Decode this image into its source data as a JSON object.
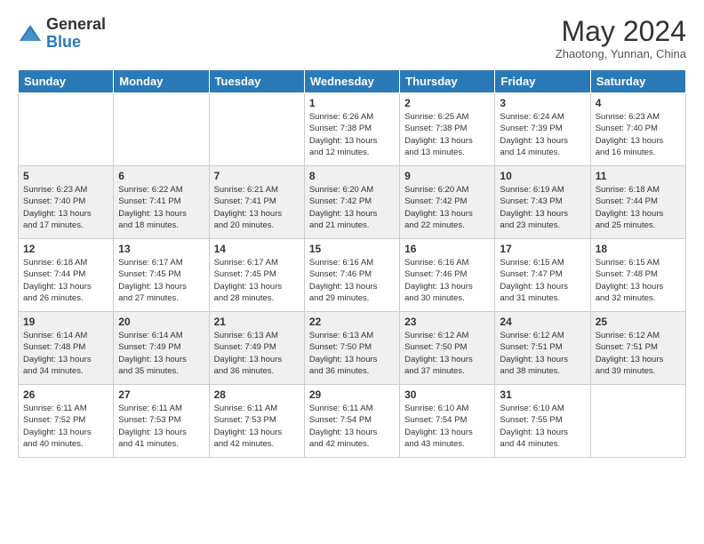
{
  "header": {
    "logo_general": "General",
    "logo_blue": "Blue",
    "month_year": "May 2024",
    "location": "Zhaotong, Yunnan, China"
  },
  "days_of_week": [
    "Sunday",
    "Monday",
    "Tuesday",
    "Wednesday",
    "Thursday",
    "Friday",
    "Saturday"
  ],
  "weeks": [
    [
      {
        "num": "",
        "info": ""
      },
      {
        "num": "",
        "info": ""
      },
      {
        "num": "",
        "info": ""
      },
      {
        "num": "1",
        "info": "Sunrise: 6:26 AM\nSunset: 7:38 PM\nDaylight: 13 hours\nand 12 minutes."
      },
      {
        "num": "2",
        "info": "Sunrise: 6:25 AM\nSunset: 7:38 PM\nDaylight: 13 hours\nand 13 minutes."
      },
      {
        "num": "3",
        "info": "Sunrise: 6:24 AM\nSunset: 7:39 PM\nDaylight: 13 hours\nand 14 minutes."
      },
      {
        "num": "4",
        "info": "Sunrise: 6:23 AM\nSunset: 7:40 PM\nDaylight: 13 hours\nand 16 minutes."
      }
    ],
    [
      {
        "num": "5",
        "info": "Sunrise: 6:23 AM\nSunset: 7:40 PM\nDaylight: 13 hours\nand 17 minutes."
      },
      {
        "num": "6",
        "info": "Sunrise: 6:22 AM\nSunset: 7:41 PM\nDaylight: 13 hours\nand 18 minutes."
      },
      {
        "num": "7",
        "info": "Sunrise: 6:21 AM\nSunset: 7:41 PM\nDaylight: 13 hours\nand 20 minutes."
      },
      {
        "num": "8",
        "info": "Sunrise: 6:20 AM\nSunset: 7:42 PM\nDaylight: 13 hours\nand 21 minutes."
      },
      {
        "num": "9",
        "info": "Sunrise: 6:20 AM\nSunset: 7:42 PM\nDaylight: 13 hours\nand 22 minutes."
      },
      {
        "num": "10",
        "info": "Sunrise: 6:19 AM\nSunset: 7:43 PM\nDaylight: 13 hours\nand 23 minutes."
      },
      {
        "num": "11",
        "info": "Sunrise: 6:18 AM\nSunset: 7:44 PM\nDaylight: 13 hours\nand 25 minutes."
      }
    ],
    [
      {
        "num": "12",
        "info": "Sunrise: 6:18 AM\nSunset: 7:44 PM\nDaylight: 13 hours\nand 26 minutes."
      },
      {
        "num": "13",
        "info": "Sunrise: 6:17 AM\nSunset: 7:45 PM\nDaylight: 13 hours\nand 27 minutes."
      },
      {
        "num": "14",
        "info": "Sunrise: 6:17 AM\nSunset: 7:45 PM\nDaylight: 13 hours\nand 28 minutes."
      },
      {
        "num": "15",
        "info": "Sunrise: 6:16 AM\nSunset: 7:46 PM\nDaylight: 13 hours\nand 29 minutes."
      },
      {
        "num": "16",
        "info": "Sunrise: 6:16 AM\nSunset: 7:46 PM\nDaylight: 13 hours\nand 30 minutes."
      },
      {
        "num": "17",
        "info": "Sunrise: 6:15 AM\nSunset: 7:47 PM\nDaylight: 13 hours\nand 31 minutes."
      },
      {
        "num": "18",
        "info": "Sunrise: 6:15 AM\nSunset: 7:48 PM\nDaylight: 13 hours\nand 32 minutes."
      }
    ],
    [
      {
        "num": "19",
        "info": "Sunrise: 6:14 AM\nSunset: 7:48 PM\nDaylight: 13 hours\nand 34 minutes."
      },
      {
        "num": "20",
        "info": "Sunrise: 6:14 AM\nSunset: 7:49 PM\nDaylight: 13 hours\nand 35 minutes."
      },
      {
        "num": "21",
        "info": "Sunrise: 6:13 AM\nSunset: 7:49 PM\nDaylight: 13 hours\nand 36 minutes."
      },
      {
        "num": "22",
        "info": "Sunrise: 6:13 AM\nSunset: 7:50 PM\nDaylight: 13 hours\nand 36 minutes."
      },
      {
        "num": "23",
        "info": "Sunrise: 6:12 AM\nSunset: 7:50 PM\nDaylight: 13 hours\nand 37 minutes."
      },
      {
        "num": "24",
        "info": "Sunrise: 6:12 AM\nSunset: 7:51 PM\nDaylight: 13 hours\nand 38 minutes."
      },
      {
        "num": "25",
        "info": "Sunrise: 6:12 AM\nSunset: 7:51 PM\nDaylight: 13 hours\nand 39 minutes."
      }
    ],
    [
      {
        "num": "26",
        "info": "Sunrise: 6:11 AM\nSunset: 7:52 PM\nDaylight: 13 hours\nand 40 minutes."
      },
      {
        "num": "27",
        "info": "Sunrise: 6:11 AM\nSunset: 7:53 PM\nDaylight: 13 hours\nand 41 minutes."
      },
      {
        "num": "28",
        "info": "Sunrise: 6:11 AM\nSunset: 7:53 PM\nDaylight: 13 hours\nand 42 minutes."
      },
      {
        "num": "29",
        "info": "Sunrise: 6:11 AM\nSunset: 7:54 PM\nDaylight: 13 hours\nand 42 minutes."
      },
      {
        "num": "30",
        "info": "Sunrise: 6:10 AM\nSunset: 7:54 PM\nDaylight: 13 hours\nand 43 minutes."
      },
      {
        "num": "31",
        "info": "Sunrise: 6:10 AM\nSunset: 7:55 PM\nDaylight: 13 hours\nand 44 minutes."
      },
      {
        "num": "",
        "info": ""
      }
    ]
  ]
}
